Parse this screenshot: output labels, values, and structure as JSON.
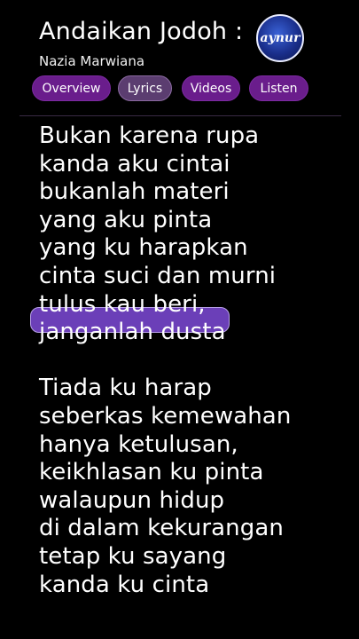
{
  "header": {
    "title": "Andaikan Jodoh :",
    "artist": "Nazia Marwiana",
    "logo_text": "aynur"
  },
  "tabs": [
    {
      "label": "Overview",
      "active": false
    },
    {
      "label": "Lyrics",
      "active": true
    },
    {
      "label": "Videos",
      "active": false
    },
    {
      "label": "Listen",
      "active": false
    }
  ],
  "lyrics": {
    "verse1": [
      "Bukan karena rupa",
      "kanda aku cintai",
      "bukanlah materi",
      "yang aku pinta",
      "yang ku harapkan",
      "cinta suci dan murni",
      "tulus kau beri,",
      "janganlah dusta"
    ],
    "verse2": [
      "Tiada ku harap",
      "seberkas kemewahan",
      "hanya ketulusan,",
      "keikhlasan ku pinta",
      "walaupun hidup",
      "di dalam kekurangan",
      "tetap ku sayang",
      "kanda ku cinta"
    ]
  },
  "colors": {
    "background": "#000000",
    "tab": "#6a1d8c",
    "tab_active": "#5b3d70",
    "highlight": "#6b3fb8"
  }
}
